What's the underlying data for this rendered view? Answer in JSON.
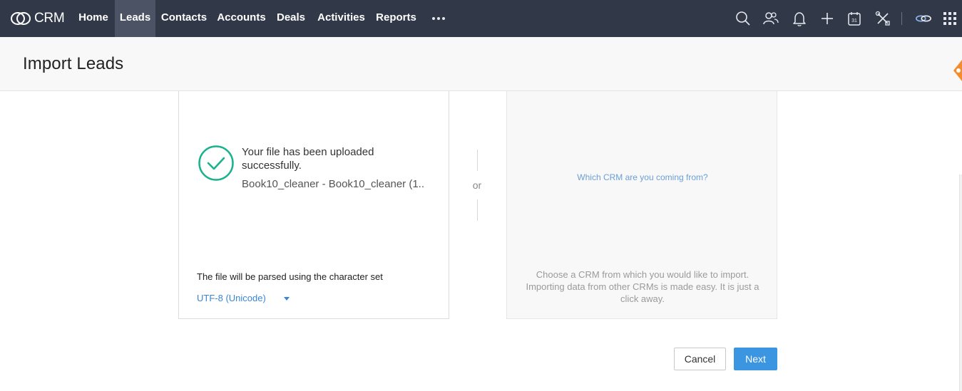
{
  "app": {
    "name": "CRM"
  },
  "nav": {
    "items": [
      {
        "label": "Home",
        "active": false
      },
      {
        "label": "Leads",
        "active": true
      },
      {
        "label": "Contacts",
        "active": false
      },
      {
        "label": "Accounts",
        "active": false
      },
      {
        "label": "Deals",
        "active": false
      },
      {
        "label": "Activities",
        "active": false
      },
      {
        "label": "Reports",
        "active": false
      }
    ],
    "more_icon": "ellipsis-icon",
    "tool_icons": [
      "search-icon",
      "users-icon",
      "bell-icon",
      "plus-icon",
      "calendar-icon",
      "tools-icon",
      "link-icon",
      "grid-icon"
    ],
    "calendar_day": "31"
  },
  "page": {
    "title": "Import Leads"
  },
  "upload": {
    "message": "Your file has been uploaded successfully.",
    "filename": "Book10_cleaner - Book10_cleaner (1...",
    "charset_label": "The file will be parsed using the character set",
    "charset_value": "UTF-8 (Unicode)"
  },
  "divider": {
    "or": "or"
  },
  "crm": {
    "link": "Which CRM are you coming from?",
    "description": "Choose a CRM from which you would like to import. Importing data from other CRMs is made easy. It is just a click away."
  },
  "buttons": {
    "cancel": "Cancel",
    "next": "Next"
  },
  "colors": {
    "topbar": "#313949",
    "active_tab": "#4b5364",
    "accent": "#3b95e0",
    "success": "#1bb38e",
    "side_tab": "#f28c2e"
  }
}
